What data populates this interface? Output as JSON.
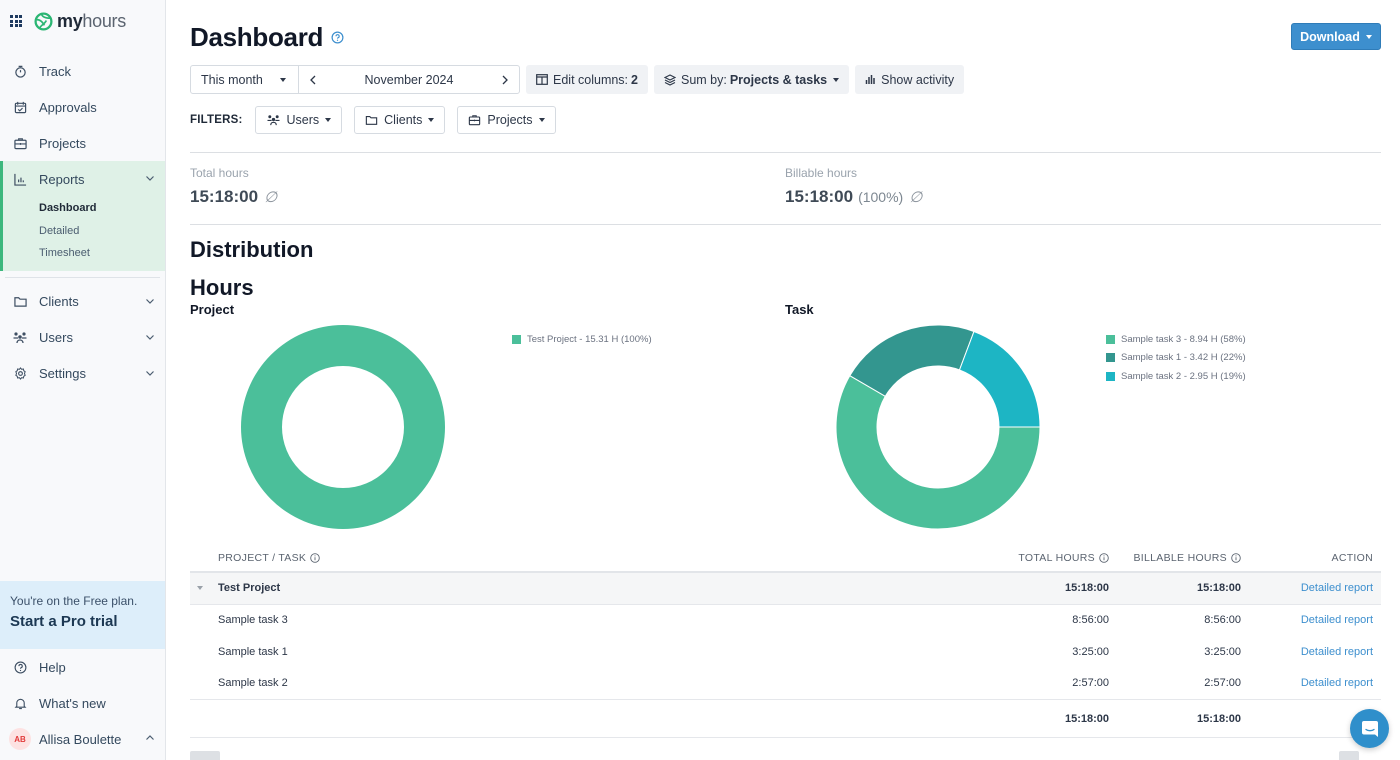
{
  "app": {
    "logo_bold": "my",
    "logo_light": "hours"
  },
  "sidebar": {
    "items": [
      {
        "label": "Track",
        "icon": "stopwatch-icon"
      },
      {
        "label": "Approvals",
        "icon": "calendar-check-icon"
      },
      {
        "label": "Projects",
        "icon": "briefcase-icon"
      }
    ],
    "reports": {
      "label": "Reports",
      "icon": "bar-chart-icon",
      "subitems": [
        "Dashboard",
        "Detailed",
        "Timesheet"
      ],
      "active_subitem": "Dashboard"
    },
    "items2": [
      {
        "label": "Clients",
        "icon": "folder-icon"
      },
      {
        "label": "Users",
        "icon": "users-icon"
      },
      {
        "label": "Settings",
        "icon": "gear-icon"
      }
    ],
    "promo": {
      "line1": "You're on the Free plan.",
      "line2": "Start a Pro trial"
    },
    "bottom": [
      {
        "label": "Help",
        "icon": "help-circle-icon"
      },
      {
        "label": "What's new",
        "icon": "bell-icon"
      }
    ],
    "user": {
      "initials": "AB",
      "name": "Allisa Boulette"
    }
  },
  "header": {
    "title": "Dashboard",
    "download_label": "Download"
  },
  "toolbar": {
    "period": "This month",
    "range": "November 2024",
    "edit_columns_label": "Edit columns:",
    "edit_columns_count": "2",
    "sum_by_label": "Sum by:",
    "sum_by_value": "Projects & tasks",
    "show_activity": "Show activity"
  },
  "filters": {
    "label": "FILTERS:",
    "users": "Users",
    "clients": "Clients",
    "projects": "Projects"
  },
  "stats": {
    "total_label": "Total hours",
    "total_value": "15:18:00",
    "billable_label": "Billable hours",
    "billable_value": "15:18:00",
    "billable_pct": "(100%)",
    "empty_symbol": "∅"
  },
  "sections": {
    "distribution": "Distribution",
    "hours": "Hours"
  },
  "chart_data": [
    {
      "type": "pie",
      "title": "Project",
      "donut": true,
      "categories": [
        "Test Project"
      ],
      "values": [
        15.31
      ],
      "percent": [
        100
      ],
      "colors": [
        "#4bbf9a"
      ],
      "legend": [
        "Test Project - 15.31 H (100%)"
      ],
      "legend_position": "right"
    },
    {
      "type": "pie",
      "title": "Task",
      "donut": true,
      "categories": [
        "Sample task 3",
        "Sample task 1",
        "Sample task 2"
      ],
      "values": [
        8.94,
        3.42,
        2.95
      ],
      "percent": [
        58,
        22,
        19
      ],
      "colors": [
        "#4bbf9a",
        "#33968f",
        "#1db5c4"
      ],
      "legend": [
        "Sample task 3 - 8.94 H (58%)",
        "Sample task 1 - 3.42 H (22%)",
        "Sample task 2 - 2.95 H (19%)"
      ],
      "legend_position": "right"
    }
  ],
  "table": {
    "headers": {
      "name": "PROJECT / TASK",
      "total": "TOTAL HOURS",
      "billable": "BILLABLE HOURS",
      "action": "ACTION"
    },
    "project": {
      "name": "Test Project",
      "total": "15:18:00",
      "billable": "15:18:00",
      "action": "Detailed report"
    },
    "tasks": [
      {
        "name": "Sample task 3",
        "total": "8:56:00",
        "billable": "8:56:00",
        "action": "Detailed report"
      },
      {
        "name": "Sample task 1",
        "total": "3:25:00",
        "billable": "3:25:00",
        "action": "Detailed report"
      },
      {
        "name": "Sample task 2",
        "total": "2:57:00",
        "billable": "2:57:00",
        "action": "Detailed report"
      }
    ],
    "footer": {
      "total": "15:18:00",
      "billable": "15:18:00"
    }
  }
}
